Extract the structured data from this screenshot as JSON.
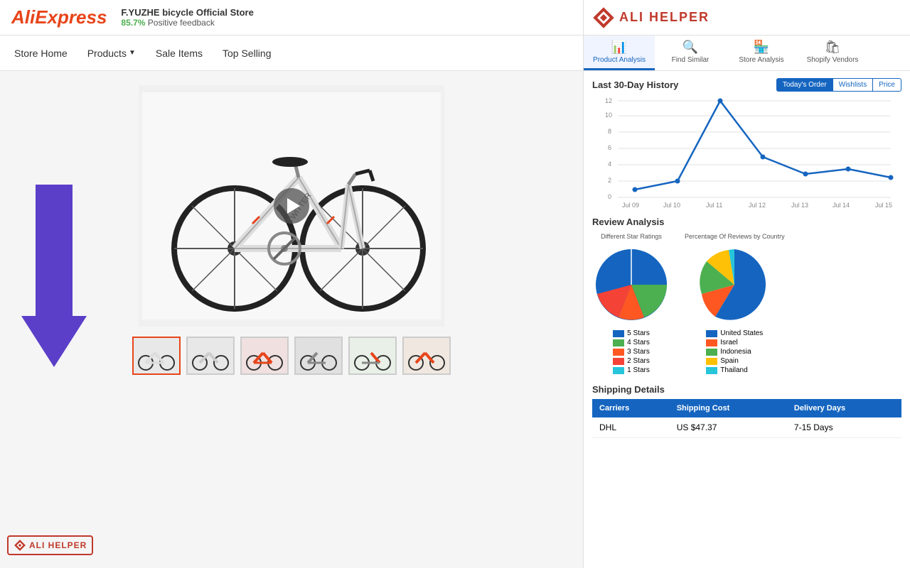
{
  "aliexpress": {
    "logo": "AliExpress",
    "store_name": "F.YUZHE bicycle Official Store",
    "store_feedback_pct": "85.7%",
    "store_feedback_label": "Positive feedback"
  },
  "alihelper": {
    "logo_text": "Ali Helper",
    "header_text": "ALI HELPER"
  },
  "nav": {
    "items": [
      {
        "label": "Store Home",
        "has_arrow": false
      },
      {
        "label": "Products",
        "has_arrow": true
      },
      {
        "label": "Sale Items",
        "has_arrow": false
      },
      {
        "label": "Top Selling",
        "has_arrow": false
      }
    ]
  },
  "ah_tabs": [
    {
      "label": "Product Analysis",
      "icon": "📊",
      "active": true
    },
    {
      "label": "Find Similar",
      "icon": "🔍",
      "active": false
    },
    {
      "label": "Store Analysis",
      "icon": "🏪",
      "active": false
    },
    {
      "label": "Shopify Vendors",
      "icon": "🛍",
      "active": false
    }
  ],
  "history": {
    "title": "Last 30-Day History",
    "buttons": [
      "Today's Order",
      "Wishlists",
      "Price"
    ],
    "active_btn": "Today's Order",
    "chart": {
      "y_labels": [
        "0",
        "2",
        "4",
        "6",
        "8",
        "10",
        "12"
      ],
      "x_labels": [
        "Jul 09",
        "Jul 10",
        "Jul 11",
        "Jul 12",
        "Jul 13",
        "Jul 14",
        "Jul 15"
      ]
    }
  },
  "review": {
    "title": "Review Analysis",
    "star_chart_title": "Different Star Ratings",
    "country_chart_title": "Percentage Of Reviews by Country",
    "stars": [
      {
        "label": "5 Stars",
        "color": "#1565C0"
      },
      {
        "label": "4 Stars",
        "color": "#4CAF50"
      },
      {
        "label": "3 Stars",
        "color": "#FF5722"
      },
      {
        "label": "2 Stars",
        "color": "#F44336"
      },
      {
        "label": "1 Stars",
        "color": "#26C5DA"
      }
    ],
    "countries": [
      {
        "label": "United States",
        "color": "#1565C0"
      },
      {
        "label": "Israel",
        "color": "#FF5722"
      },
      {
        "label": "Indonesia",
        "color": "#4CAF50"
      },
      {
        "label": "Spain",
        "color": "#FFC107"
      },
      {
        "label": "Thailand",
        "color": "#26C5DA"
      }
    ]
  },
  "shipping": {
    "title": "Shipping Details",
    "headers": [
      "Carriers",
      "Shipping Cost",
      "Delivery Days"
    ],
    "rows": [
      {
        "carrier": "DHL",
        "cost": "US $47.37",
        "days": "7-15 Days"
      }
    ]
  },
  "arrow": {
    "color": "#5b3fc8"
  }
}
